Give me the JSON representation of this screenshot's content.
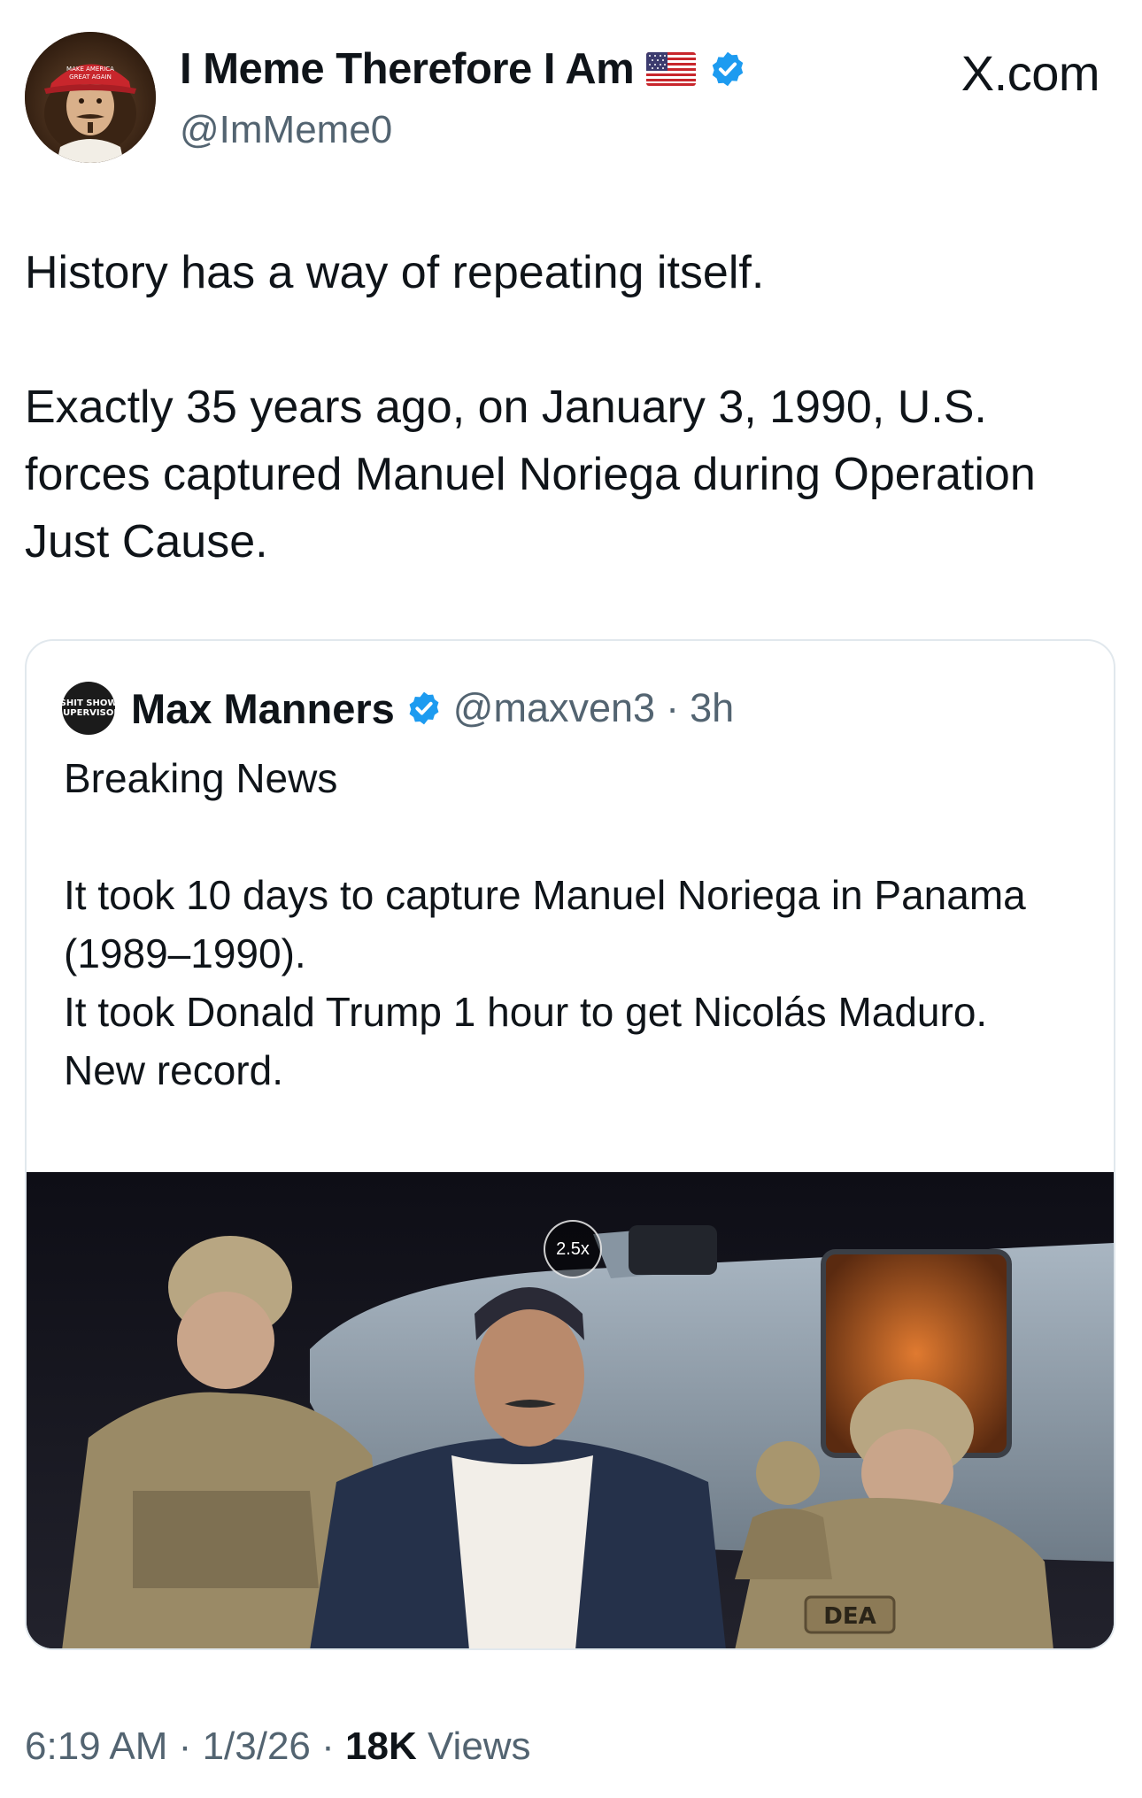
{
  "author": {
    "display_name": "I Meme Therefore I Am",
    "handle": "@ImMeme0",
    "avatar_hat_text": "MAKE AMERICA GREAT AGAIN",
    "icons": [
      "us-flag-icon",
      "verified-badge-icon"
    ]
  },
  "site": {
    "label": "X.com"
  },
  "tweet": {
    "paragraphs": [
      "History has a way of repeating itself.",
      "Exactly 35 years ago, on January 3, 1990, U.S. forces captured Manuel Noriega during Operation Just Cause."
    ]
  },
  "quote": {
    "avatar_text_line1": "SHIT SHOW",
    "avatar_text_line2": "SUPERVISOR",
    "name": "Max Manners",
    "handle": "@maxven3",
    "separator": "·",
    "time": "3h",
    "lines": [
      "Breaking News",
      "It took 10 days to capture Manuel Noriega in Panama (1989–1990).",
      "It took Donald Trump 1 hour to get Nicolás Maduro.",
      "New record."
    ],
    "media": {
      "zoom_badge": "2.5x",
      "patch_text": "DEA"
    }
  },
  "meta": {
    "time": "6:19 AM",
    "sep1": "·",
    "date": "1/3/26",
    "sep2": "·",
    "views_count": "18K",
    "views_label": "Views"
  },
  "colors": {
    "text": "#0f1419",
    "secondary": "#536471",
    "verified": "#1d9bf0",
    "border": "#e1e8ed"
  }
}
